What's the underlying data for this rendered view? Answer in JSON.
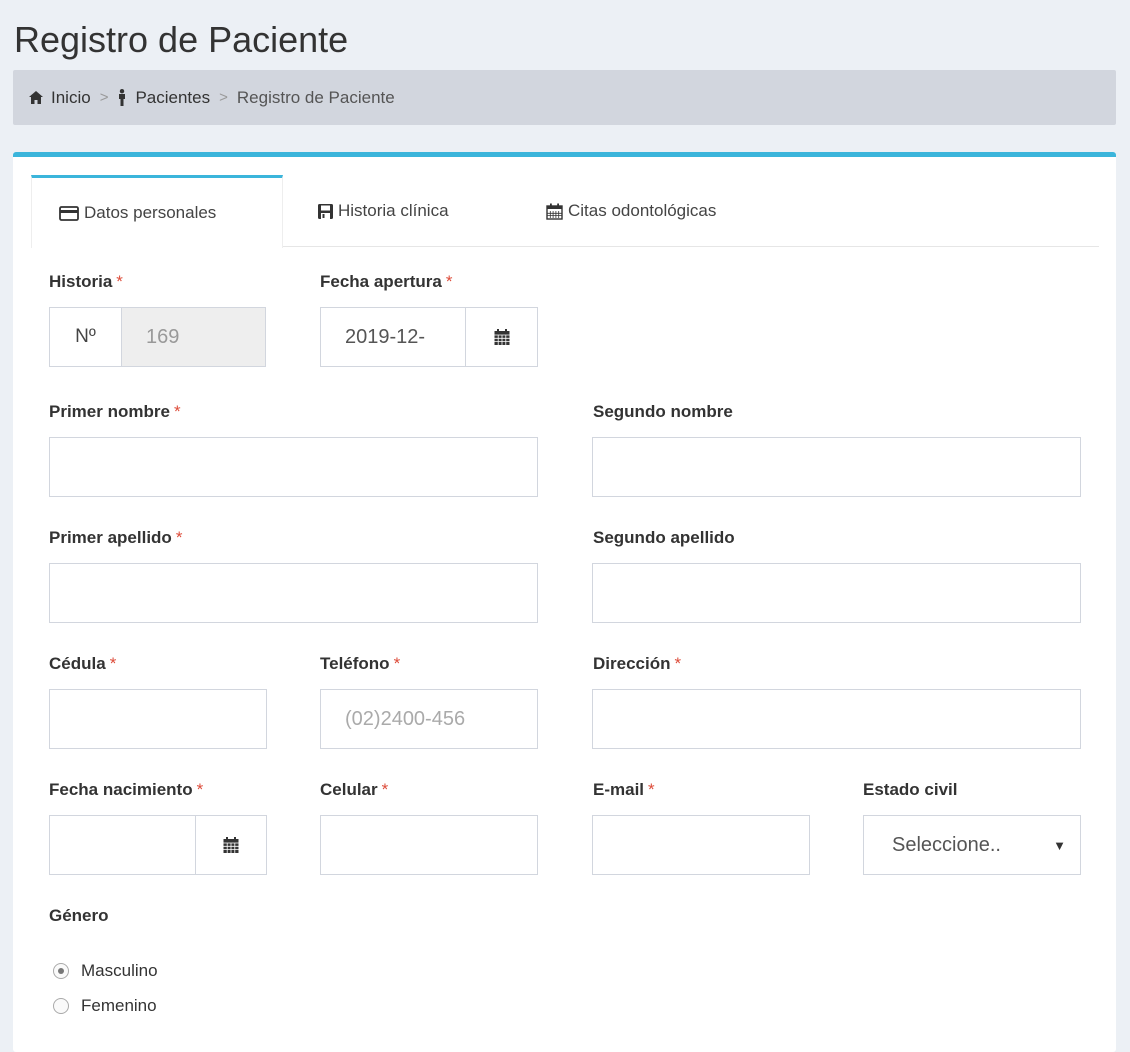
{
  "page": {
    "title": "Registro de Paciente"
  },
  "breadcrumb": {
    "home": "Inicio",
    "sep1": ">",
    "patients": "Pacientes",
    "sep2": ">",
    "current": "Registro de Paciente"
  },
  "colors": {
    "accent": "#3bb5db",
    "required": "#dd4b39"
  },
  "tabs": [
    {
      "label": "Datos personales",
      "icon": "credit-card-icon",
      "active": true
    },
    {
      "label": "Historia clínica",
      "icon": "save-icon",
      "active": false
    },
    {
      "label": "Citas odontológicas",
      "icon": "calendar-icon",
      "active": false
    }
  ],
  "required_mark": "*",
  "form": {
    "historia": {
      "label": "Historia",
      "prefix": "Nº",
      "value": "169"
    },
    "fecha_apertura": {
      "label": "Fecha apertura",
      "value": "2019-12-"
    },
    "primer_nombre": {
      "label": "Primer nombre",
      "value": ""
    },
    "segundo_nombre": {
      "label": "Segundo nombre",
      "value": ""
    },
    "primer_apellido": {
      "label": "Primer apellido",
      "value": ""
    },
    "segundo_apellido": {
      "label": "Segundo apellido",
      "value": ""
    },
    "cedula": {
      "label": "Cédula",
      "value": ""
    },
    "telefono": {
      "label": "Teléfono",
      "placeholder": "(02)2400-456"
    },
    "direccion": {
      "label": "Dirección",
      "value": ""
    },
    "fecha_nacimiento": {
      "label": "Fecha nacimiento",
      "value": ""
    },
    "celular": {
      "label": "Celular",
      "value": ""
    },
    "email": {
      "label": "E-mail",
      "value": ""
    },
    "estado_civil": {
      "label": "Estado civil",
      "selected": "Seleccione.."
    },
    "genero": {
      "label": "Género",
      "options": [
        {
          "label": "Masculino",
          "checked": true
        },
        {
          "label": "Femenino",
          "checked": false
        }
      ]
    }
  }
}
